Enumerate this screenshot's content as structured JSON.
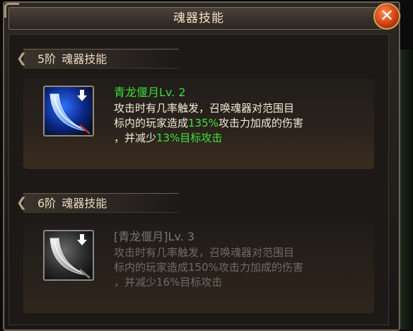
{
  "window": {
    "title": "魂器技能",
    "close_label": "✕"
  },
  "sections": [
    {
      "tier": "5阶",
      "header": "魂器技能",
      "skill_name": "青龙偃月Lv. 2",
      "desc_line1": "攻击时有几率触发，召唤魂器对范围目",
      "desc_line2_pre": "标内的玩家造成",
      "desc_line2_hl": "135%",
      "desc_line2_post": "攻击力加成的伤害",
      "desc_line3_pre": "，并减少",
      "desc_line3_hl": "13%目标攻击",
      "desc_line3_post": ""
    },
    {
      "tier": "6阶",
      "header": "魂器技能",
      "skill_name": "[青龙偃月]Lv. 3",
      "desc_line1": "攻击时有几率触发，召唤魂器对范围目",
      "desc_line2_pre": "标内的玩家造成",
      "desc_line2_hl": "150%",
      "desc_line2_post": "攻击力加成的伤害",
      "desc_line3_pre": "，并减少",
      "desc_line3_hl": "16%",
      "desc_line3_post": "目标攻击"
    }
  ],
  "icons": {
    "active": "crescent-blade-icon",
    "locked": "crescent-blade-icon",
    "badge": "down-arrow-icon"
  },
  "colors": {
    "skill_active": "#3bdc3b",
    "highlight": "#41e03c",
    "locked_text": "#6f6a64",
    "title_text": "#f1e3c4"
  }
}
